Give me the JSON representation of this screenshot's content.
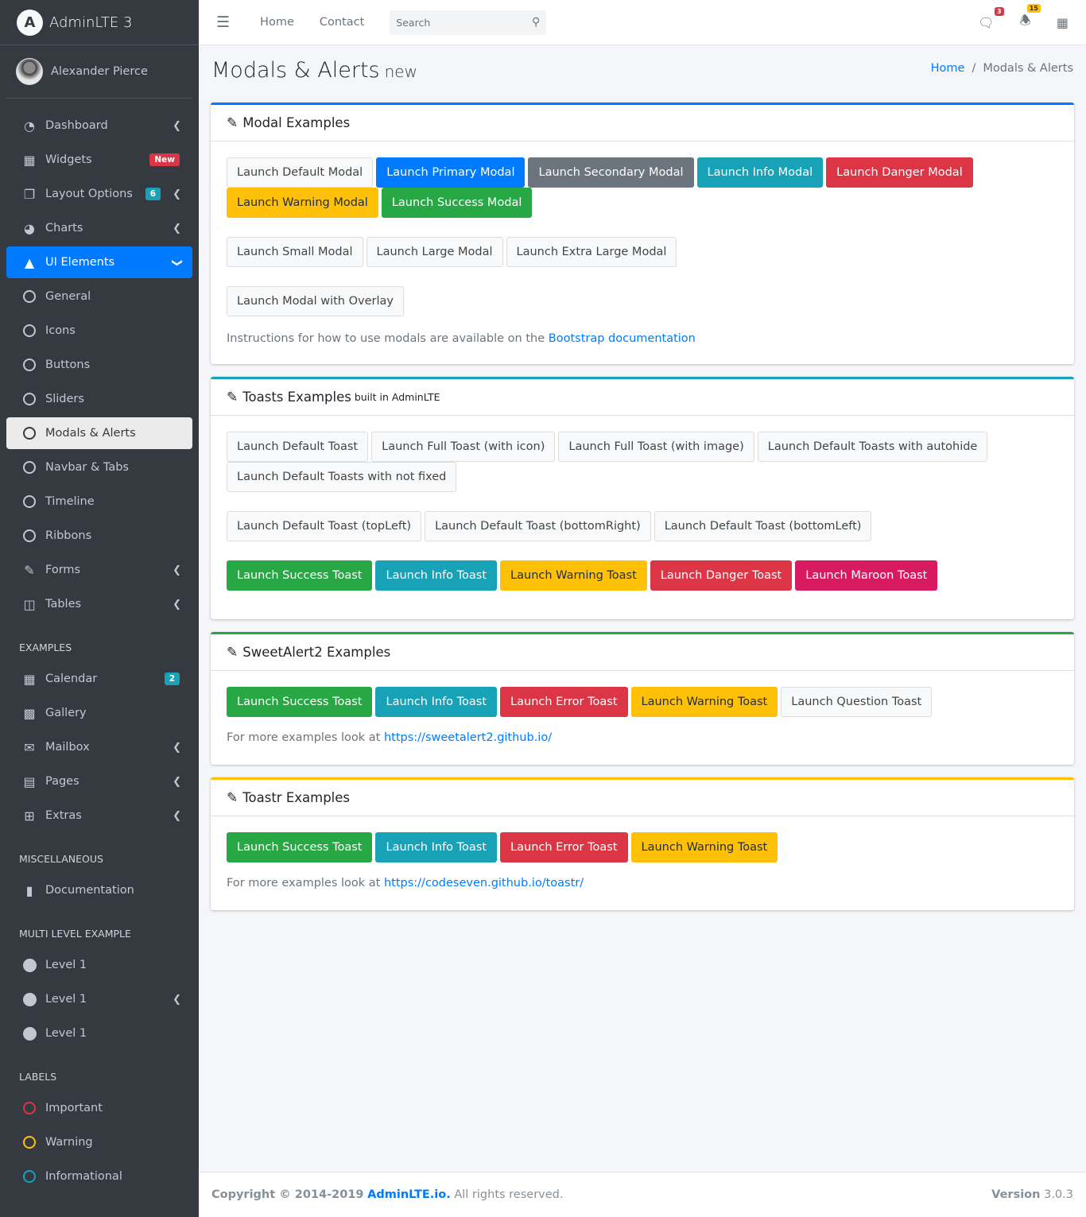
{
  "brand": {
    "name": "AdminLTE 3",
    "logo_letter": "A"
  },
  "user": {
    "name": "Alexander Pierce"
  },
  "sidebar": {
    "items": [
      {
        "label": "Dashboard",
        "icon": "dashboard-icon"
      },
      {
        "label": "Widgets",
        "icon": "widgets-icon",
        "badge": "New"
      },
      {
        "label": "Layout Options",
        "icon": "copy-icon",
        "badge": "6"
      },
      {
        "label": "Charts",
        "icon": "pie-chart-icon"
      },
      {
        "label": "UI Elements",
        "icon": "tree-icon"
      },
      {
        "label": "General"
      },
      {
        "label": "Icons"
      },
      {
        "label": "Buttons"
      },
      {
        "label": "Sliders"
      },
      {
        "label": "Modals & Alerts"
      },
      {
        "label": "Navbar & Tabs"
      },
      {
        "label": "Timeline"
      },
      {
        "label": "Ribbons"
      },
      {
        "label": "Forms",
        "icon": "edit-icon"
      },
      {
        "label": "Tables",
        "icon": "table-icon"
      }
    ],
    "examples_header": "EXAMPLES",
    "examples": [
      {
        "label": "Calendar",
        "badge": "2"
      },
      {
        "label": "Gallery"
      },
      {
        "label": "Mailbox"
      },
      {
        "label": "Pages"
      },
      {
        "label": "Extras"
      }
    ],
    "misc_header": "MISCELLANEOUS",
    "misc": [
      {
        "label": "Documentation"
      }
    ],
    "multi_header": "MULTI LEVEL EXAMPLE",
    "multi": [
      {
        "label": "Level 1"
      },
      {
        "label": "Level 1"
      },
      {
        "label": "Level 1"
      }
    ],
    "labels_header": "LABELS",
    "labels": [
      {
        "label": "Important",
        "color": "#dc3545"
      },
      {
        "label": "Warning",
        "color": "#ffc107"
      },
      {
        "label": "Informational",
        "color": "#17a2b8"
      }
    ]
  },
  "topbar": {
    "home": "Home",
    "contact": "Contact",
    "search_placeholder": "Search",
    "messages_count": "3",
    "notifications_count": "15"
  },
  "page": {
    "title": "Modals & Alerts",
    "title_small": "new",
    "breadcrumb": [
      "Home",
      "Modals & Alerts"
    ]
  },
  "modal_card": {
    "title": "Modal Examples",
    "row1": [
      "Launch Default Modal",
      "Launch Primary Modal",
      "Launch Secondary Modal",
      "Launch Info Modal",
      "Launch Danger Modal",
      "Launch Warning Modal",
      "Launch Success Modal"
    ],
    "row2": [
      "Launch Small Modal",
      "Launch Large Modal",
      "Launch Extra Large Modal"
    ],
    "row3": [
      "Launch Modal with Overlay"
    ],
    "note": "Instructions for how to use modals are available on the",
    "note_link": "Bootstrap documentation"
  },
  "toasts_card": {
    "title": "Toasts Examples",
    "title_small": "built in AdminLTE",
    "row1": [
      "Launch Default Toast",
      "Launch Full Toast (with icon)",
      "Launch Full Toast (with image)",
      "Launch Default Toasts with autohide",
      "Launch Default Toasts with not fixed"
    ],
    "row2": [
      "Launch Default Toast (topLeft)",
      "Launch Default Toast (bottomRight)",
      "Launch Default Toast (bottomLeft)"
    ],
    "row3": [
      "Launch Success Toast",
      "Launch Info Toast",
      "Launch Warning Toast",
      "Launch Danger Toast",
      "Launch Maroon Toast"
    ]
  },
  "sweet_card": {
    "title": "SweetAlert2 Examples",
    "buttons": [
      "Launch Success Toast",
      "Launch Info Toast",
      "Launch Error Toast",
      "Launch Warning Toast",
      "Launch Question Toast"
    ],
    "note": "For more examples look at",
    "link": "https://sweetalert2.github.io/"
  },
  "toastr_card": {
    "title": "Toastr Examples",
    "buttons": [
      "Launch Success Toast",
      "Launch Info Toast",
      "Launch Error Toast",
      "Launch Warning Toast"
    ],
    "note": "For more examples look at",
    "link": "https://codeseven.github.io/toastr/"
  },
  "footer": {
    "copyright": "Copyright © 2014-2019",
    "link": "AdminLTE.io.",
    "rights": "All rights reserved.",
    "version_label": "Version",
    "version": "3.0.3"
  },
  "colors": {
    "primary": "#007bff",
    "secondary": "#6c757d",
    "info": "#17a2b8",
    "danger": "#dc3545",
    "warning": "#ffc107",
    "success": "#28a745",
    "maroon": "#d81b60",
    "sidebar": "#343a40"
  }
}
